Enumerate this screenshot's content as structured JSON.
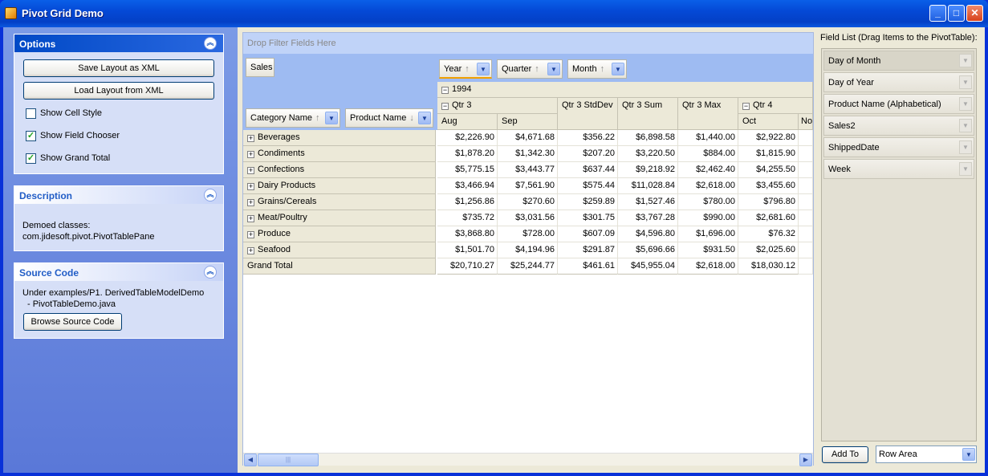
{
  "window": {
    "title": "Pivot Grid Demo",
    "minimize": "_",
    "maximize": "□",
    "close": "✕"
  },
  "options_panel": {
    "title": "Options",
    "collapse_icon": "︽",
    "save_button": "Save Layout as XML",
    "load_button": "Load Layout from XML",
    "checkboxes": [
      {
        "label": "Show Cell Style",
        "checked": false
      },
      {
        "label": "Show Field Chooser",
        "checked": true
      },
      {
        "label": "Show Grand Total",
        "checked": true
      }
    ]
  },
  "description_panel": {
    "title": "Description",
    "line1": "Demoed classes:",
    "line2": "com.jidesoft.pivot.PivotTablePane"
  },
  "source_panel": {
    "title": "Source Code",
    "line1": "Under examples/P1. DerivedTableModelDemo",
    "line2": "- PivotTableDemo.java",
    "browse_button": "Browse Source Code"
  },
  "pivot": {
    "filter_placeholder": "Drop Filter Fields Here",
    "data_field": "Sales",
    "column_fields": [
      {
        "label": "Year",
        "sort": "↑"
      },
      {
        "label": "Quarter",
        "sort": "↑"
      },
      {
        "label": "Month",
        "sort": "↑"
      }
    ],
    "row_fields": [
      {
        "label": "Category Name",
        "sort": "↑"
      },
      {
        "label": "Product Name",
        "sort": "↓"
      }
    ],
    "year_header": "1994",
    "qtr3_header": "Qtr 3",
    "qtr4_header": "Qtr 4",
    "stddev_header": "Qtr 3 StdDev",
    "sum_header": "Qtr 3 Sum",
    "max_header": "Qtr 3 Max",
    "month_headers": [
      "Aug",
      "Sep",
      "Oct",
      "No"
    ],
    "rows": [
      {
        "label": "Beverages",
        "values": [
          "$2,226.90",
          "$4,671.68",
          "$356.22",
          "$6,898.58",
          "$1,440.00",
          "$2,922.80"
        ]
      },
      {
        "label": "Condiments",
        "values": [
          "$1,878.20",
          "$1,342.30",
          "$207.20",
          "$3,220.50",
          "$884.00",
          "$1,815.90"
        ]
      },
      {
        "label": "Confections",
        "values": [
          "$5,775.15",
          "$3,443.77",
          "$637.44",
          "$9,218.92",
          "$2,462.40",
          "$4,255.50"
        ]
      },
      {
        "label": "Dairy Products",
        "values": [
          "$3,466.94",
          "$7,561.90",
          "$575.44",
          "$11,028.84",
          "$2,618.00",
          "$3,455.60"
        ]
      },
      {
        "label": "Grains/Cereals",
        "values": [
          "$1,256.86",
          "$270.60",
          "$259.89",
          "$1,527.46",
          "$780.00",
          "$796.80"
        ]
      },
      {
        "label": "Meat/Poultry",
        "values": [
          "$735.72",
          "$3,031.56",
          "$301.75",
          "$3,767.28",
          "$990.00",
          "$2,681.60"
        ]
      },
      {
        "label": "Produce",
        "values": [
          "$3,868.80",
          "$728.00",
          "$607.09",
          "$4,596.80",
          "$1,696.00",
          "$76.32"
        ]
      },
      {
        "label": "Seafood",
        "values": [
          "$1,501.70",
          "$4,194.96",
          "$291.87",
          "$5,696.66",
          "$931.50",
          "$2,025.60"
        ]
      }
    ],
    "grand_total": {
      "label": "Grand Total",
      "values": [
        "$20,710.27",
        "$25,244.77",
        "$461.61",
        "$45,955.04",
        "$2,618.00",
        "$18,030.12"
      ]
    }
  },
  "field_list": {
    "title": "Field List (Drag Items to the PivotTable):",
    "items": [
      "Day of Month",
      "Day of Year",
      "Product Name (Alphabetical)",
      "Sales2",
      "ShippedDate",
      "Week"
    ],
    "add_button": "Add To",
    "area_selected": "Row Area"
  }
}
